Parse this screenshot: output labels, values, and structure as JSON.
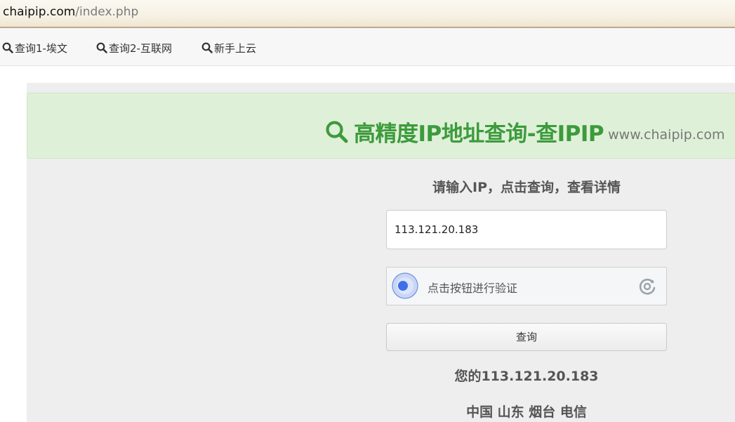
{
  "browser": {
    "url_host": "chaipip.com",
    "url_path": "/index.php"
  },
  "nav": {
    "items": [
      {
        "label": "查询1-埃文",
        "icon": "search-icon"
      },
      {
        "label": "查询2-互联网",
        "icon": "search-icon"
      },
      {
        "label": "新手上云",
        "icon": "search-icon"
      }
    ]
  },
  "banner": {
    "title": "高精度IP地址查询-查IPIP",
    "domain": "www.chaipip.com",
    "icon": "search-icon",
    "title_color": "#3c9b3c",
    "background_color": "#dff0d8"
  },
  "form": {
    "prompt": "请输入IP，点击查询，查看详情",
    "ip_value": "113.121.20.183",
    "captcha_label": "点击按钮进行验证",
    "submit_label": "查询"
  },
  "result": {
    "ip_line": "您的113.121.20.183",
    "location_line": "中国 山东 烟台 电信"
  }
}
